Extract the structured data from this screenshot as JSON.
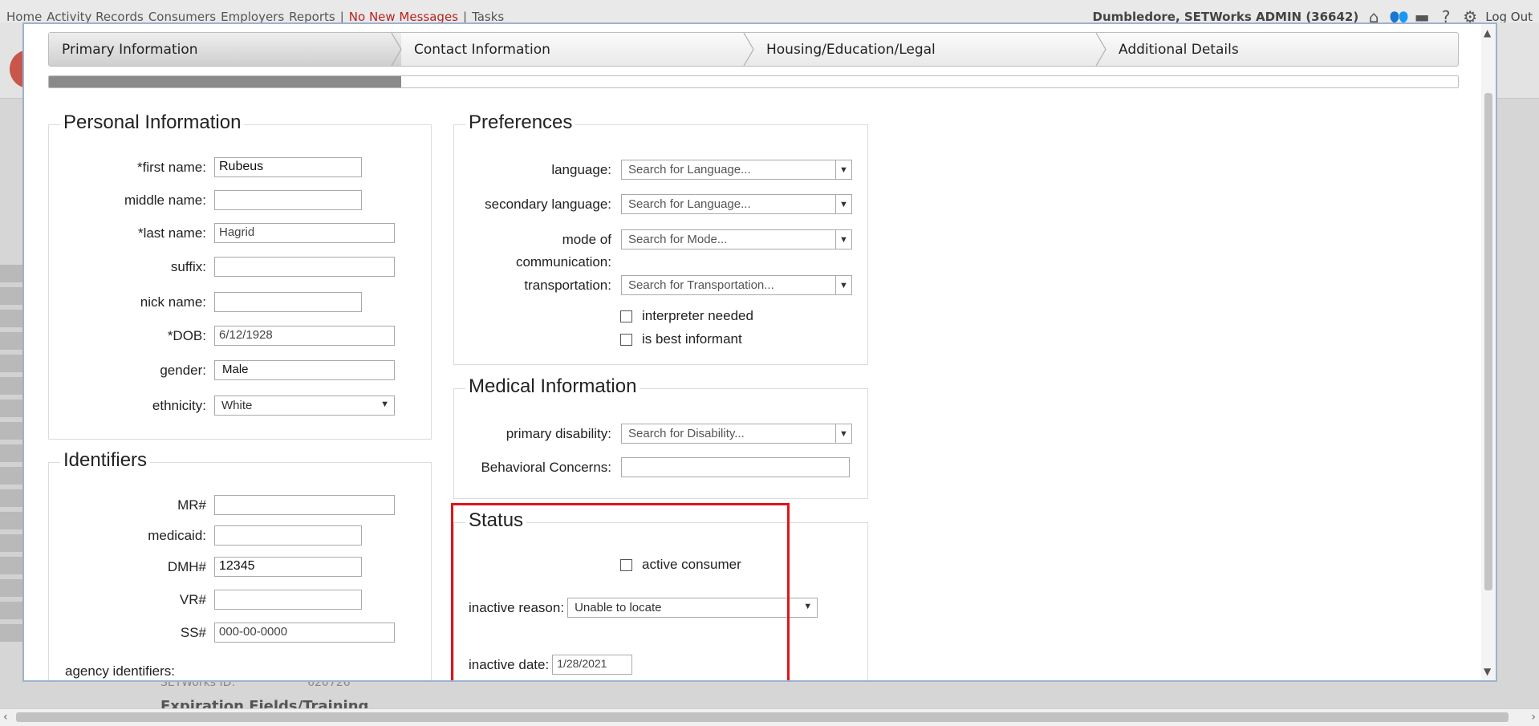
{
  "bg": {
    "nav_links": [
      "Home",
      "Activity Records",
      "Consumers",
      "Employers",
      "Reports",
      "|",
      "No New Messages",
      "|",
      "Tasks"
    ],
    "user": "Dumbledore, SETWorks ADMIN (36642)",
    "logout": "Log Out",
    "bottom_label": "Expiration Fields/Training",
    "bottom_id_label": "SETWorks ID:",
    "bottom_id_value": "620726"
  },
  "wizard": {
    "steps": [
      "Primary Information",
      "Contact Information",
      "Housing/Education/Legal",
      "Additional Details"
    ],
    "active_index": 0,
    "progress": 0.25
  },
  "personal": {
    "title": "Personal Information",
    "first_name_label": "*first name:",
    "first_name": "Rubeus",
    "middle_name_label": "middle name:",
    "middle_name": "",
    "last_name_label": "*last name:",
    "last_name": "Hagrid",
    "suffix_label": "suffix:",
    "suffix": "",
    "nick_name_label": "nick name:",
    "nick_name": "",
    "dob_label": "*DOB:",
    "dob": "6/12/1928",
    "gender_label": "gender:",
    "gender": "Male",
    "ethnicity_label": "ethnicity:",
    "ethnicity": "White"
  },
  "identifiers": {
    "title": "Identifiers",
    "mr_label": "MR#",
    "mr": "",
    "medicaid_label": "medicaid:",
    "medicaid": "",
    "dmh_label": "DMH#",
    "dmh": "12345",
    "vr_label": "VR#",
    "vr": "",
    "ss_label": "SS#",
    "ss": "000-00-0000",
    "agency_label": "agency identifiers:"
  },
  "preferences": {
    "title": "Preferences",
    "language_label": "language:",
    "language_placeholder": "Search for Language...",
    "secondary_label": "secondary language:",
    "secondary_placeholder": "Search for Language...",
    "mode_label_1": "mode of",
    "mode_label_2": "communication:",
    "mode_placeholder": "Search for Mode...",
    "transport_label": "transportation:",
    "transport_placeholder": "Search for Transportation...",
    "interpreter_label": "interpreter needed",
    "informant_label": "is best informant"
  },
  "medical": {
    "title": "Medical Information",
    "disability_label": "primary disability:",
    "disability_placeholder": "Search for Disability...",
    "behavioral_label": "Behavioral Concerns:",
    "behavioral": ""
  },
  "status": {
    "title": "Status",
    "active_label": "active consumer",
    "reason_label": "inactive reason:",
    "reason": "Unable to locate",
    "date_label": "inactive date:",
    "date": "1/28/2021"
  },
  "colors": {
    "highlight": "#e0141b",
    "progress": "#8a8a8a"
  }
}
